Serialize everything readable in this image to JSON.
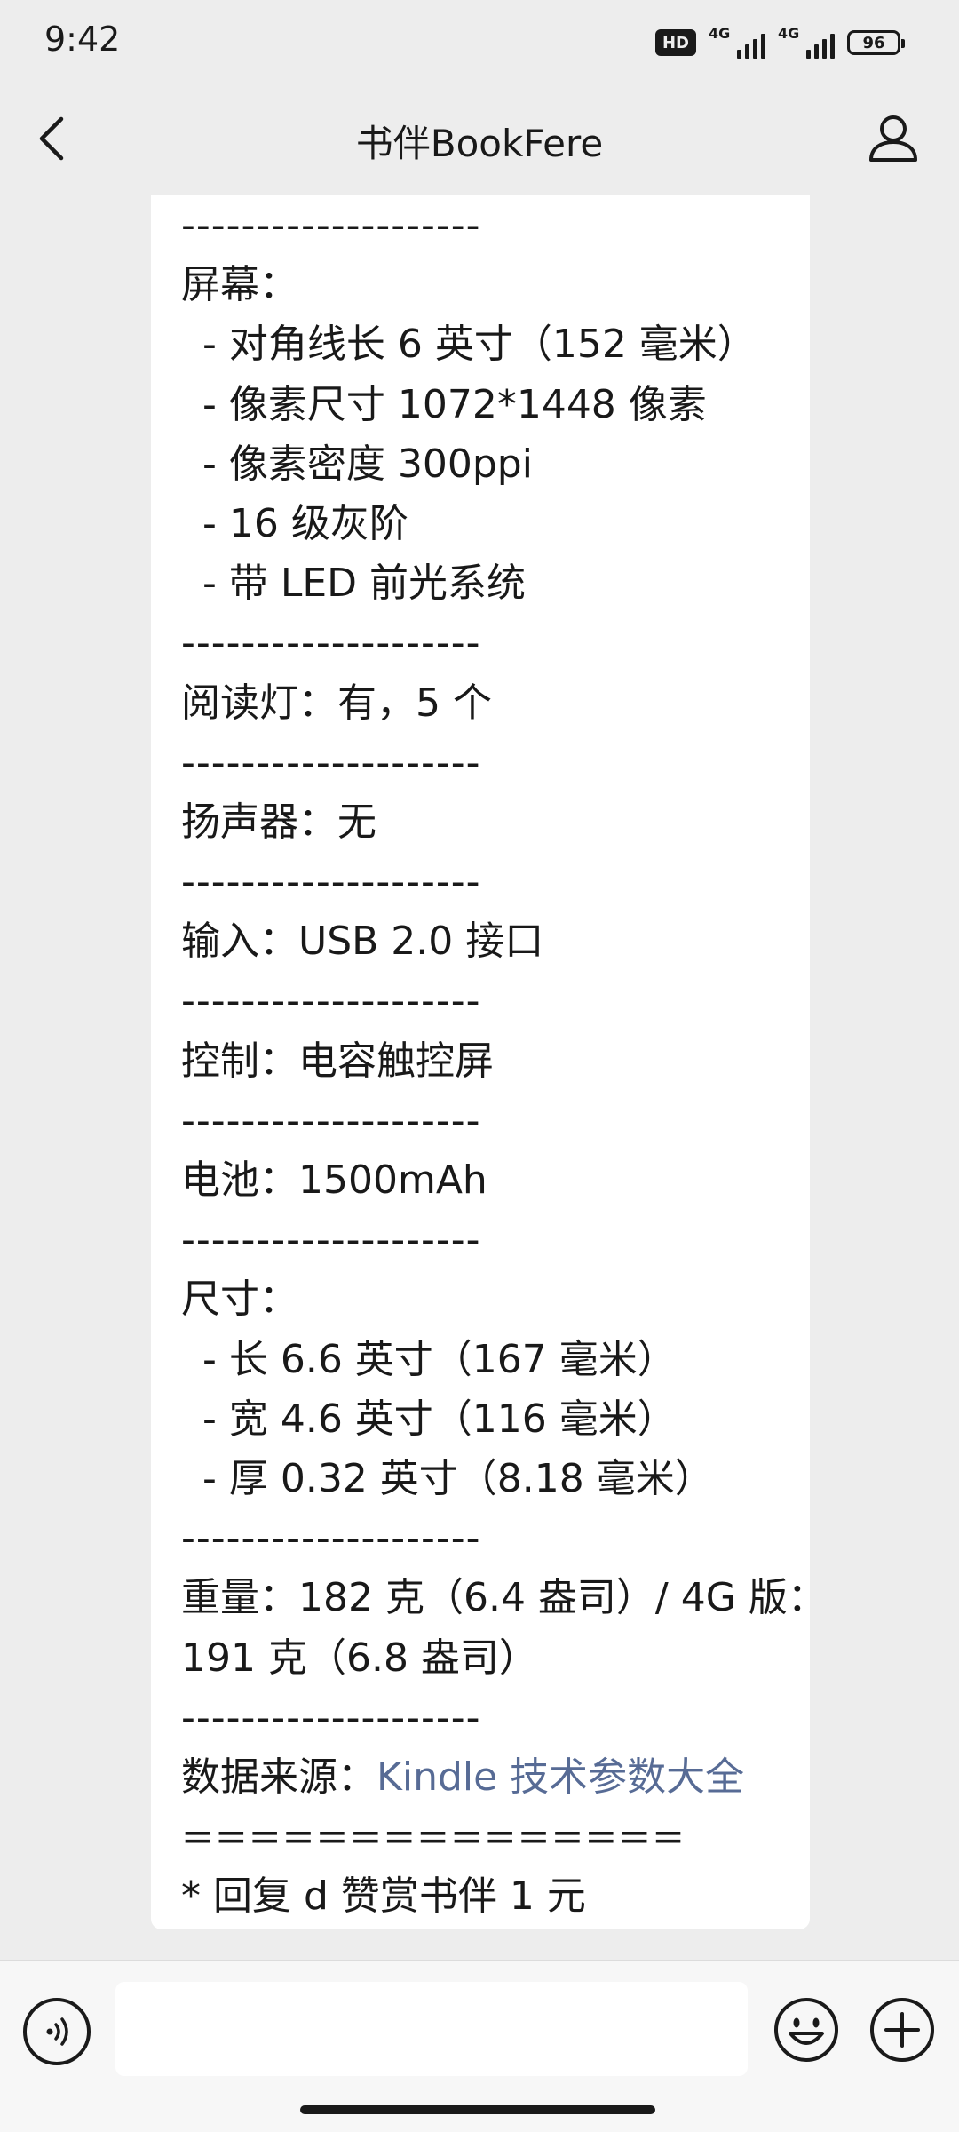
{
  "status_bar": {
    "time": "9:42",
    "hd_label": "HD",
    "network_1": "4G",
    "network_2": "4G",
    "battery": "96"
  },
  "header": {
    "title": "书伴BookFere",
    "back_icon": "chevron-left-icon",
    "profile_icon": "person-icon"
  },
  "message": {
    "lines": [
      {
        "type": "sep",
        "text": "--------------------"
      },
      {
        "type": "text",
        "text": "屏幕："
      },
      {
        "type": "indent",
        "text": "- 对角线长 6 英寸（152 毫米）"
      },
      {
        "type": "indent",
        "text": "- 像素尺寸 1072*1448 像素"
      },
      {
        "type": "indent",
        "text": "- 像素密度 300ppi"
      },
      {
        "type": "indent",
        "text": "- 16 级灰阶"
      },
      {
        "type": "indent",
        "text": "- 带 LED 前光系统"
      },
      {
        "type": "sep",
        "text": "--------------------"
      },
      {
        "type": "text",
        "text": "阅读灯：有，5 个"
      },
      {
        "type": "sep",
        "text": "--------------------"
      },
      {
        "type": "text",
        "text": "扬声器：无"
      },
      {
        "type": "sep",
        "text": "--------------------"
      },
      {
        "type": "text",
        "text": "输入：USB 2.0 接口"
      },
      {
        "type": "sep",
        "text": "--------------------"
      },
      {
        "type": "text",
        "text": "控制：电容触控屏"
      },
      {
        "type": "sep",
        "text": "--------------------"
      },
      {
        "type": "text",
        "text": "电池：1500mAh"
      },
      {
        "type": "sep",
        "text": "--------------------"
      },
      {
        "type": "text",
        "text": "尺寸："
      },
      {
        "type": "indent",
        "text": "- 长 6.6 英寸（167 毫米）"
      },
      {
        "type": "indent",
        "text": "- 宽 4.6 英寸（116 毫米）"
      },
      {
        "type": "indent",
        "text": "- 厚 0.32 英寸（8.18 毫米）"
      },
      {
        "type": "sep",
        "text": "--------------------"
      },
      {
        "type": "text",
        "text": "重量：182 克（6.4 盎司）/ 4G 版："
      },
      {
        "type": "text",
        "text": "191 克（6.8 盎司）"
      },
      {
        "type": "sep",
        "text": "--------------------"
      }
    ],
    "source_label": "数据来源：",
    "source_link": "Kindle 技术参数大全",
    "double_sep": "===============",
    "reply_hint": "* 回复 d 赞赏书伴 1 元"
  },
  "input_bar": {
    "placeholder": "",
    "voice_icon": "voice-icon",
    "emoji_icon": "emoji-icon",
    "add_icon": "plus-icon"
  }
}
